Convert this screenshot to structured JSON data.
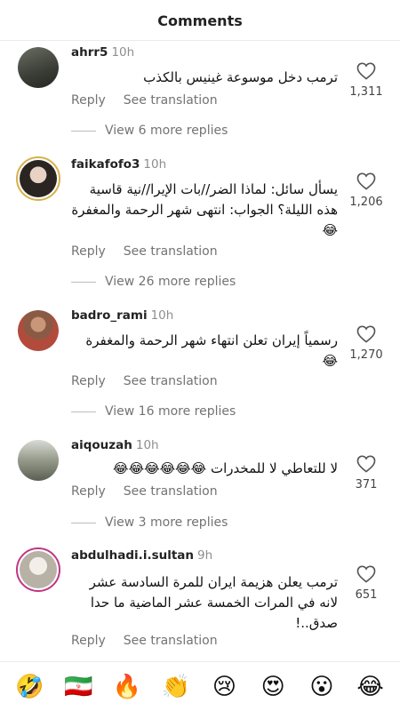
{
  "header": {
    "title": "Comments"
  },
  "actions": {
    "reply": "Reply",
    "translate": "See translation"
  },
  "comments": [
    {
      "username": "ahrr5",
      "time": "10h",
      "text": "ترمب دخل موسوعة غينيس بالكذب",
      "likes": "1,311",
      "view_more": "View 6 more replies"
    },
    {
      "username": "faikafofo3",
      "time": "10h",
      "text": "يسأل سائل: لماذا الضر//بات الإيرا//نية قاسية هذه الليلة؟ الجواب: انتهى شهر الرحمة والمغفرة😂",
      "likes": "1,206",
      "view_more": "View 26 more replies"
    },
    {
      "username": "badro_rami",
      "time": "10h",
      "text": "رسمياً إيران تعلن انتهاء شهر الرحمة والمغفرة 😂",
      "likes": "1,270",
      "view_more": "View 16 more replies"
    },
    {
      "username": "aiqouzah",
      "time": "10h",
      "text": "لا للتعاطي لا للمخدرات 😂😂😂😂😂😂",
      "likes": "371",
      "view_more": "View 3 more replies"
    },
    {
      "username": "abdulhadi.i.sultan",
      "time": "9h",
      "text": "ترمب يعلن هزيمة ايران للمرة السادسة عشر لانه في المرات الخمسة عشر الماضية ما حدا صدق..!",
      "likes": "651"
    }
  ],
  "emoji_bar": [
    "🤣",
    "🇮🇷",
    "🔥",
    "👏",
    "😢",
    "😍",
    "😮",
    "😂"
  ]
}
